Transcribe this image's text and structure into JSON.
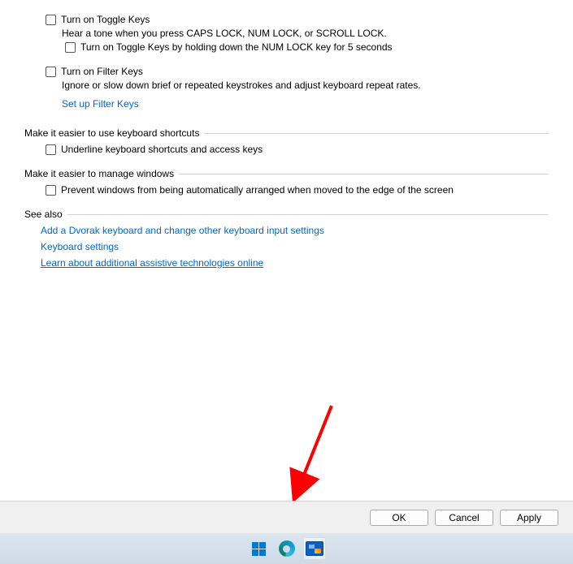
{
  "options": {
    "toggleKeys": {
      "label": "Turn on Toggle Keys",
      "desc": "Hear a tone when you press CAPS LOCK, NUM LOCK, or SCROLL LOCK.",
      "subLabel": "Turn on Toggle Keys by holding down the NUM LOCK key for 5 seconds"
    },
    "filterKeys": {
      "label": "Turn on Filter Keys",
      "desc": "Ignore or slow down brief or repeated keystrokes and adjust keyboard repeat rates.",
      "link": "Set up Filter Keys"
    }
  },
  "sections": {
    "shortcuts": {
      "title": "Make it easier to use keyboard shortcuts",
      "underline": "Underline keyboard shortcuts and access keys"
    },
    "windows": {
      "title": "Make it easier to manage windows",
      "prevent": "Prevent windows from being automatically arranged when moved to the edge of the screen"
    },
    "seeAlso": {
      "title": "See also",
      "links": [
        "Add a Dvorak keyboard and change other keyboard input settings",
        "Keyboard settings",
        "Learn about additional assistive technologies online"
      ]
    }
  },
  "buttons": {
    "ok": "OK",
    "cancel": "Cancel",
    "apply": "Apply"
  }
}
